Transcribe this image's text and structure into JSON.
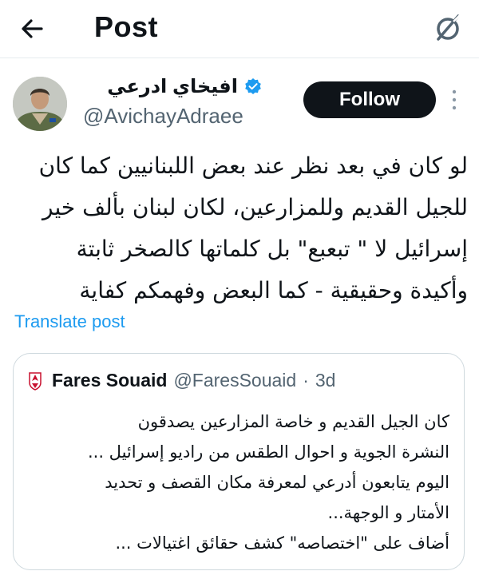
{
  "header": {
    "title": "Post",
    "back_icon": "arrow-left-icon",
    "grok_icon": "grok-icon"
  },
  "author": {
    "name": "افيخاي ادرعي",
    "handle": "@AvichayAdraee",
    "verified": true,
    "follow_label": "Follow",
    "more_icon": "more-vertical-icon"
  },
  "post": {
    "text": "لو كان في بعد نظر عند بعض اللبنانيين كما كان\nللجيل القديم وللمزارعين، لكان لبنان بألف خير\nإسرائيل لا \" تبعبع\" بل كلماتها كالصخر ثابتة\nوأكيدة وحقيقية - كما البعض وفهمكم كفاية",
    "translate_label": "Translate post"
  },
  "quote": {
    "name": "Fares Souaid",
    "handle": "@FaresSouaid",
    "separator": "·",
    "time": "3d",
    "text": "كان الجيل القديم و خاصة المزارعين يصدقون\nالنشرة الجوية و احوال الطقس من راديو إسرائيل ...\nاليوم يتابعون أدرعي لمعرفة مكان القصف و تحديد\nالأمتار و الوجهة...\nأضاف على \"اختصاصه\" كشف حقائق اغتيالات ..."
  },
  "colors": {
    "text": "#0f1419",
    "secondary": "#536471",
    "link": "#1d9bf0",
    "border": "#cfd9de",
    "follow_bg": "#0f1419"
  }
}
